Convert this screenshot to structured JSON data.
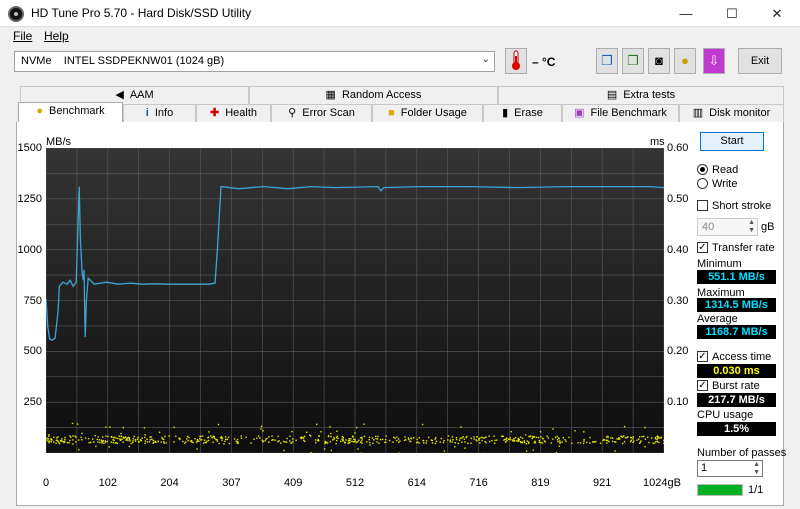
{
  "window": {
    "title": "HD Tune Pro 5.70 - Hard Disk/SSD Utility",
    "minimize": "—",
    "maximize": "☐",
    "close": "✕"
  },
  "menu": {
    "file": "File",
    "help": "Help"
  },
  "toolbar": {
    "drive": "NVMe    INTEL SSDPEKNW01 (1024 gB)",
    "temperature": "– °C",
    "exit": "Exit"
  },
  "tabs_top": [
    {
      "label": "AAM"
    },
    {
      "label": "Random Access"
    },
    {
      "label": "Extra tests"
    }
  ],
  "tabs_bottom": [
    {
      "label": "Benchmark"
    },
    {
      "label": "Info"
    },
    {
      "label": "Health"
    },
    {
      "label": "Error Scan"
    },
    {
      "label": "Folder Usage"
    },
    {
      "label": "Erase"
    },
    {
      "label": "File Benchmark"
    },
    {
      "label": "Disk monitor"
    }
  ],
  "side": {
    "start": "Start",
    "read": "Read",
    "write": "Write",
    "short_stroke": "Short stroke",
    "stroke_value": "40",
    "stroke_unit": "gB",
    "transfer_rate": "Transfer rate",
    "minimum_label": "Minimum",
    "minimum": "551.1 MB/s",
    "maximum_label": "Maximum",
    "maximum": "1314.5 MB/s",
    "average_label": "Average",
    "average": "1168.7 MB/s",
    "access_time": "Access time",
    "access_value": "0.030 ms",
    "burst_rate": "Burst rate",
    "burst_value": "217.7 MB/s",
    "cpu_label": "CPU usage",
    "cpu_value": "1.5%",
    "passes_label": "Number of passes",
    "passes_value": "1",
    "progress_text": "1/1",
    "progress": 1.0
  },
  "colors": {
    "transfer_line": "#3aa7d8",
    "access_dots": "#e8e800",
    "minmax": "#00e0ff",
    "access_value": "#ffff00"
  },
  "chart_data": {
    "type": "line",
    "ylabel_left": "MB/s",
    "ylabel_right": "ms",
    "yticks_left": [
      "1500",
      "1250",
      "1000",
      "750",
      "500",
      "250"
    ],
    "yticks_right": [
      "0.60",
      "0.50",
      "0.40",
      "0.30",
      "0.20",
      "0.10"
    ],
    "xticks": [
      "0",
      "102",
      "204",
      "307",
      "409",
      "512",
      "614",
      "716",
      "819",
      "921",
      "1024gB"
    ],
    "ylim_left": [
      0,
      1500
    ],
    "ylim_right": [
      0,
      0.6
    ],
    "xlim": [
      0,
      1024
    ],
    "grid": true,
    "transfer_rate": [
      [
        0,
        760
      ],
      [
        3,
        620
      ],
      [
        6,
        560
      ],
      [
        10,
        555
      ],
      [
        15,
        565
      ],
      [
        20,
        700
      ],
      [
        22,
        820
      ],
      [
        28,
        840
      ],
      [
        35,
        830
      ],
      [
        40,
        850
      ],
      [
        45,
        820
      ],
      [
        50,
        840
      ],
      [
        55,
        1310
      ],
      [
        57,
        1050
      ],
      [
        60,
        880
      ],
      [
        62,
        850
      ],
      [
        63,
        900
      ],
      [
        65,
        570
      ],
      [
        67,
        750
      ],
      [
        70,
        860
      ],
      [
        80,
        830
      ],
      [
        100,
        840
      ],
      [
        120,
        830
      ],
      [
        140,
        835
      ],
      [
        160,
        830
      ],
      [
        180,
        832
      ],
      [
        200,
        830
      ],
      [
        240,
        830
      ],
      [
        270,
        830
      ],
      [
        280,
        835
      ],
      [
        284,
        1000
      ],
      [
        290,
        1310
      ],
      [
        320,
        1300
      ],
      [
        360,
        1310
      ],
      [
        400,
        1300
      ],
      [
        440,
        1310
      ],
      [
        480,
        1305
      ],
      [
        550,
        1310
      ],
      [
        555,
        1290
      ],
      [
        560,
        1305
      ],
      [
        620,
        1310
      ],
      [
        700,
        1310
      ],
      [
        780,
        1305
      ],
      [
        860,
        1310
      ],
      [
        940,
        1310
      ],
      [
        1000,
        1310
      ],
      [
        1024,
        1305
      ]
    ],
    "access_time_band_ms": [
      0.0,
      0.06
    ]
  }
}
